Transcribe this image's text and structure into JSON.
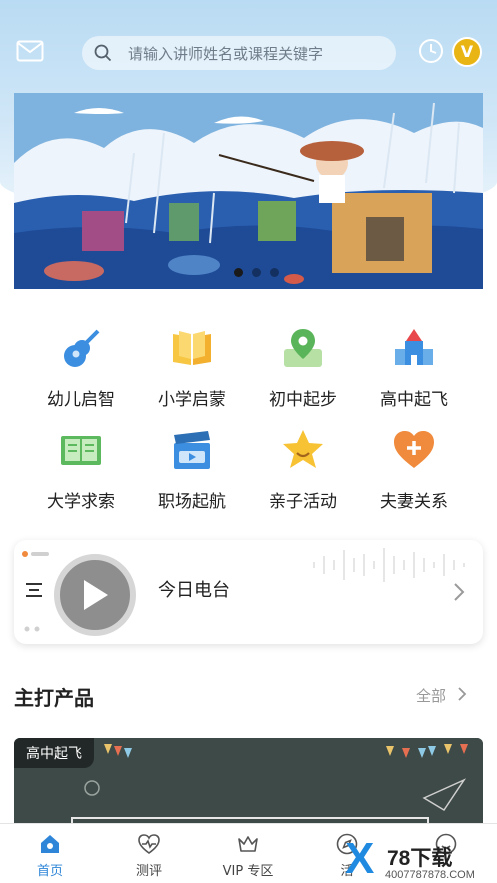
{
  "header": {
    "search_placeholder": "请输入讲师姓名或课程关键字",
    "vip_badge": "V"
  },
  "banner": {
    "slide_count": 3,
    "active_slide": 1
  },
  "categories": [
    {
      "label": "幼儿启智",
      "icon": "guitar-icon"
    },
    {
      "label": "小学启蒙",
      "icon": "open-book-icon"
    },
    {
      "label": "初中起步",
      "icon": "map-pin-icon"
    },
    {
      "label": "高中起飞",
      "icon": "castle-icon"
    },
    {
      "label": "大学求索",
      "icon": "book-icon"
    },
    {
      "label": "职场起航",
      "icon": "clapperboard-icon"
    },
    {
      "label": "亲子活动",
      "icon": "star-icon"
    },
    {
      "label": "夫妻关系",
      "icon": "heart-plus-icon"
    }
  ],
  "radio": {
    "title": "今日电台"
  },
  "featured": {
    "title": "主打产品",
    "see_all": "全部",
    "product_tag": "高中起飞"
  },
  "tabbar": [
    {
      "label": "首页",
      "icon": "home-icon",
      "active": true
    },
    {
      "label": "测评",
      "icon": "heart-pulse-icon",
      "active": false
    },
    {
      "label": "VIP 专区",
      "icon": "crown-icon",
      "active": false
    },
    {
      "label": "活",
      "icon": "compass-icon",
      "active": false
    },
    {
      "label": "",
      "icon": "profile-icon",
      "active": false
    }
  ],
  "watermark": {
    "logo": "X",
    "title": "78下载",
    "url": "4007787878.COM"
  },
  "colors": {
    "accent": "#2f86d8",
    "vip": "#e9b514"
  }
}
